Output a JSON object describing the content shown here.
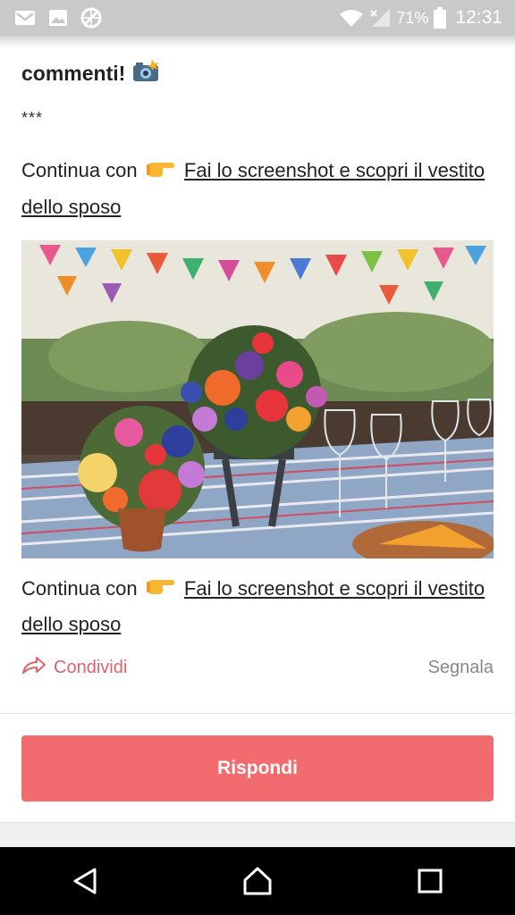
{
  "status_bar": {
    "battery": "71%",
    "time": "12:31",
    "icons": [
      "gmail-icon",
      "gallery-icon",
      "vpn-icon",
      "wifi-icon",
      "signal-icon",
      "battery-icon"
    ]
  },
  "post": {
    "heading": "commenti!",
    "heading_emoji": "camera-flash-emoji",
    "separator": "***",
    "continue_prefix_1": "Continua con",
    "link_1": "Fai lo screenshot e scopri il vestito dello sposo",
    "image_alt": "colorful-wedding-table-flowers-photo",
    "continue_prefix_2": "Continua con",
    "link_2": "Fai lo screenshot e scopri il vestito dello sposo"
  },
  "actions": {
    "share_label": "Condividi",
    "report_label": "Segnala"
  },
  "reply_button": "Rispondi",
  "colors": {
    "accent": "#f26b6f",
    "share_text": "#e0626b",
    "status_bar": "#c9c9c9"
  }
}
